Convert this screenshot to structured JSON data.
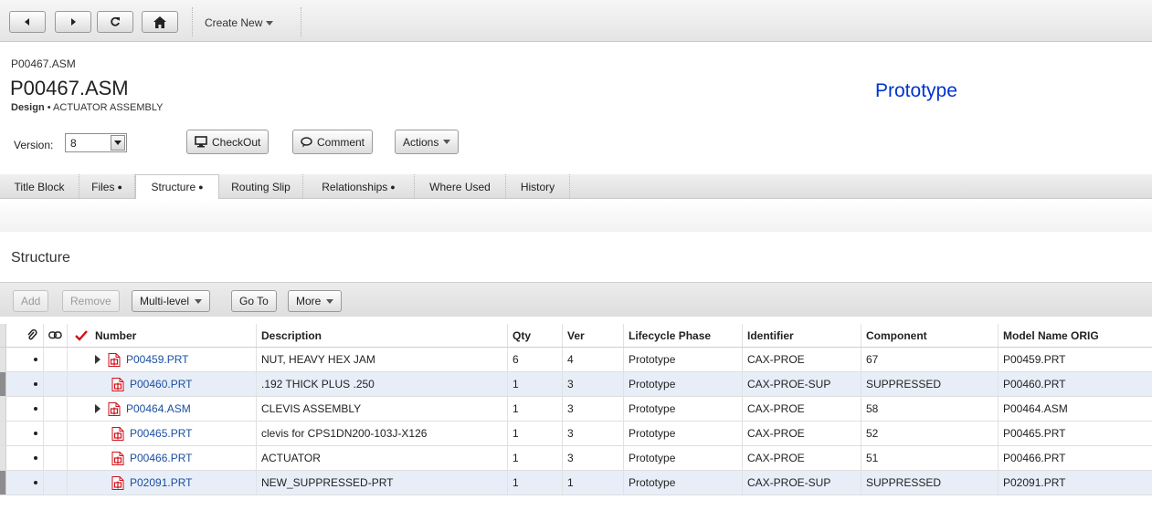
{
  "toolbar": {
    "back_icon": "back-arrow-icon",
    "forward_icon": "forward-arrow-icon",
    "refresh_icon": "refresh-icon",
    "home_icon": "home-icon",
    "create_new_label": "Create New"
  },
  "header": {
    "breadcrumb": "P00467.ASM",
    "title": "P00467.ASM",
    "type_label": "Design",
    "separator": " • ",
    "description": "ACTUATOR ASSEMBLY",
    "lifecycle_state": "Prototype",
    "version_label": "Version:",
    "version_value": "8",
    "checkout_label": "CheckOut",
    "comment_label": "Comment",
    "actions_label": "Actions"
  },
  "tabs": [
    {
      "label": "Title Block",
      "dot": ""
    },
    {
      "label": "Files",
      "dot": "●"
    },
    {
      "label": "Structure",
      "dot": "●"
    },
    {
      "label": "Routing Slip",
      "dot": ""
    },
    {
      "label": "Relationships",
      "dot": "●"
    },
    {
      "label": "Where Used",
      "dot": ""
    },
    {
      "label": "History",
      "dot": ""
    }
  ],
  "section_title": "Structure",
  "table_toolbar": {
    "add_label": "Add",
    "remove_label": "Remove",
    "multilevel_label": "Multi-level",
    "goto_label": "Go To",
    "more_label": "More"
  },
  "columns": {
    "number": "Number",
    "description": "Description",
    "qty": "Qty",
    "ver": "Ver",
    "lifecycle": "Lifecycle Phase",
    "identifier": "Identifier",
    "component": "Component",
    "model_name": "Model Name ORIG"
  },
  "rows": [
    {
      "number": "P00459.PRT",
      "description": "NUT, HEAVY HEX JAM",
      "qty": "6",
      "ver": "4",
      "lifecycle": "Prototype",
      "identifier": "CAX-PROE",
      "component": "67",
      "model_name": "P00459.PRT"
    },
    {
      "number": "P00460.PRT",
      "description": ".192 THICK PLUS .250",
      "qty": "1",
      "ver": "3",
      "lifecycle": "Prototype",
      "identifier": "CAX-PROE-SUP",
      "component": "SUPPRESSED",
      "model_name": "P00460.PRT"
    },
    {
      "number": "P00464.ASM",
      "description": "CLEVIS ASSEMBLY",
      "qty": "1",
      "ver": "3",
      "lifecycle": "Prototype",
      "identifier": "CAX-PROE",
      "component": "58",
      "model_name": "P00464.ASM"
    },
    {
      "number": "P00465.PRT",
      "description": "clevis for CPS1DN200-103J-X126",
      "qty": "1",
      "ver": "3",
      "lifecycle": "Prototype",
      "identifier": "CAX-PROE",
      "component": "52",
      "model_name": "P00465.PRT"
    },
    {
      "number": "P00466.PRT",
      "description": "ACTUATOR",
      "qty": "1",
      "ver": "3",
      "lifecycle": "Prototype",
      "identifier": "CAX-PROE",
      "component": "51",
      "model_name": "P00466.PRT"
    },
    {
      "number": "P02091.PRT",
      "description": "NEW_SUPPRESSED-PRT",
      "qty": "1",
      "ver": "1",
      "lifecycle": "Prototype",
      "identifier": "CAX-PROE-SUP",
      "component": "SUPPRESSED",
      "model_name": "P02091.PRT"
    }
  ],
  "colors": {
    "link": "#1a4fa0",
    "state": "#0033cc",
    "alt_row": "#e8eef8",
    "check": "#d0101a",
    "part_icon": "#d0101a"
  }
}
